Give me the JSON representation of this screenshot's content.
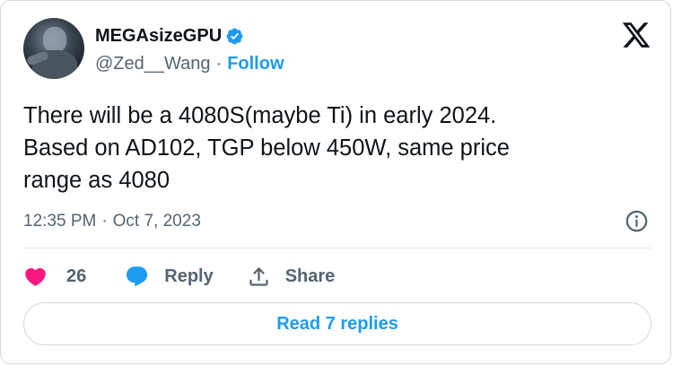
{
  "author": {
    "display_name": "MEGAsizeGPU",
    "handle": "@Zed__Wang",
    "separator": "·",
    "follow_label": "Follow",
    "verified": true
  },
  "tweet": {
    "text": "There will be a 4080S(maybe Ti) in early 2024.\nBased on AD102, TGP below 450W, same price\nrange as 4080",
    "time": "12:35 PM",
    "separator": "·",
    "date": "Oct 7, 2023"
  },
  "actions": {
    "like_count": "26",
    "reply_label": "Reply",
    "share_label": "Share"
  },
  "read_replies_label": "Read 7 replies",
  "icons": {
    "verified": "verified-badge-icon",
    "platform": "x-logo-icon",
    "info": "info-icon",
    "like": "heart-icon",
    "reply": "speech-bubble-icon",
    "share": "share-upload-icon"
  },
  "colors": {
    "accent": "#1d9bf0",
    "like": "#f91880",
    "text": "#0f1419",
    "secondary": "#536471",
    "border": "#cfd9de"
  }
}
